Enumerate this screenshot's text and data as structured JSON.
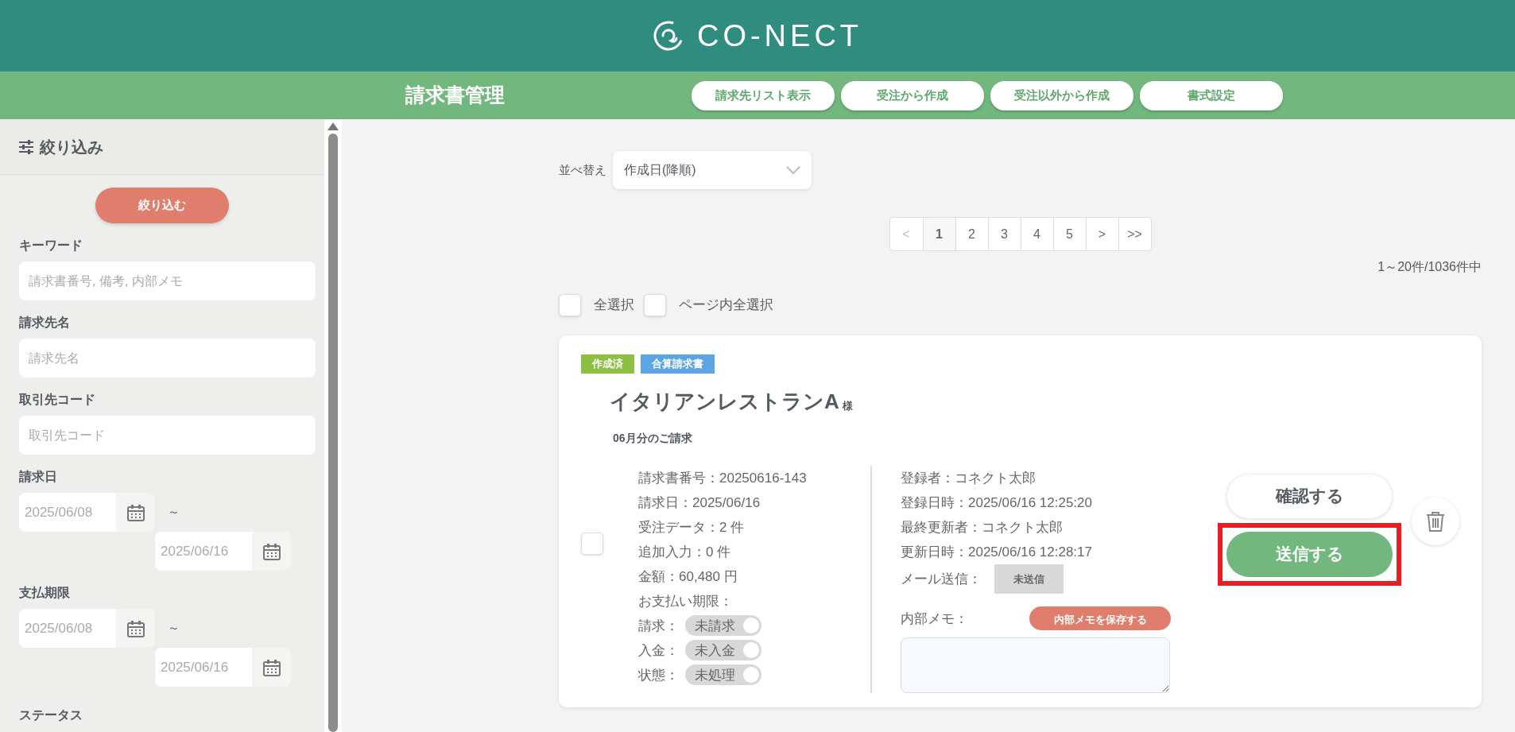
{
  "header": {
    "logo": "CO-NECT"
  },
  "subheader": {
    "title": "請求書管理",
    "nav_buttons": [
      "請求先リスト表示",
      "受注から作成",
      "受注以外から作成",
      "書式設定"
    ]
  },
  "sidebar": {
    "title": "絞り込み",
    "apply_button": "絞り込む",
    "fields": [
      {
        "kind": "text",
        "label": "キーワード",
        "placeholder": "請求書番号, 備考, 内部メモ"
      },
      {
        "kind": "text",
        "label": "請求先名",
        "placeholder": "請求先名"
      },
      {
        "kind": "text",
        "label": "取引先コード",
        "placeholder": "取引先コード"
      },
      {
        "kind": "daterange",
        "label": "請求日",
        "from_placeholder": "2025/06/08",
        "separator": "～",
        "to_placeholder": "2025/06/16"
      },
      {
        "kind": "daterange",
        "label": "支払期限",
        "from_placeholder": "2025/06/08",
        "separator": "～",
        "to_placeholder": "2025/06/16"
      },
      {
        "kind": "heading",
        "label": "ステータス"
      }
    ]
  },
  "main": {
    "sort": {
      "label": "並べ替え",
      "value": "作成日(降順)"
    },
    "pagination": [
      {
        "label": "<",
        "selected": false,
        "disabled": true
      },
      {
        "label": "1",
        "selected": true,
        "disabled": false
      },
      {
        "label": "2",
        "selected": false,
        "disabled": false
      },
      {
        "label": "3",
        "selected": false,
        "disabled": false
      },
      {
        "label": "4",
        "selected": false,
        "disabled": false
      },
      {
        "label": "5",
        "selected": false,
        "disabled": false
      },
      {
        "label": ">",
        "selected": false,
        "disabled": false
      },
      {
        "label": ">>",
        "selected": false,
        "disabled": false
      }
    ],
    "count": "1～20件/1036件中",
    "select_all": [
      {
        "label": "全選択",
        "checked": false
      },
      {
        "label": "ページ内全選択",
        "checked": false
      }
    ],
    "invoices": [
      {
        "checked": false,
        "tags": [
          {
            "text": "作成済",
            "color": "#8cc043"
          },
          {
            "text": "合算請求書",
            "color": "#5ba6e2"
          }
        ],
        "name": "イタリアンレストランA",
        "honorific": "様",
        "subtitle": "06月分のご請求",
        "details": [
          "請求書番号：20250616-143",
          "請求日：2025/06/16",
          "受注データ：2 件",
          "追加入力：0 件",
          "金額：60,480 円",
          "お支払い期限："
        ],
        "toggles": [
          {
            "label": "請求：",
            "value": "未請求",
            "on": false
          },
          {
            "label": "入金：",
            "value": "未入金",
            "on": false
          },
          {
            "label": "状態：",
            "value": "未処理",
            "on": false
          }
        ],
        "meta": [
          "登録者：コネクト太郎",
          "登録日時：2025/06/16 12:25:20",
          "最終更新者：コネクト太郎",
          "更新日時：2025/06/16 12:28:17"
        ],
        "mail": {
          "label": "メール送信：",
          "status": "未送信"
        },
        "memo": {
          "label": "内部メモ：",
          "save_button": "内部メモを保存する"
        },
        "actions": [
          {
            "kind": "confirm",
            "label": "確認する",
            "highlighted": false
          },
          {
            "kind": "send",
            "label": "送信する",
            "highlighted": true
          }
        ]
      }
    ]
  }
}
